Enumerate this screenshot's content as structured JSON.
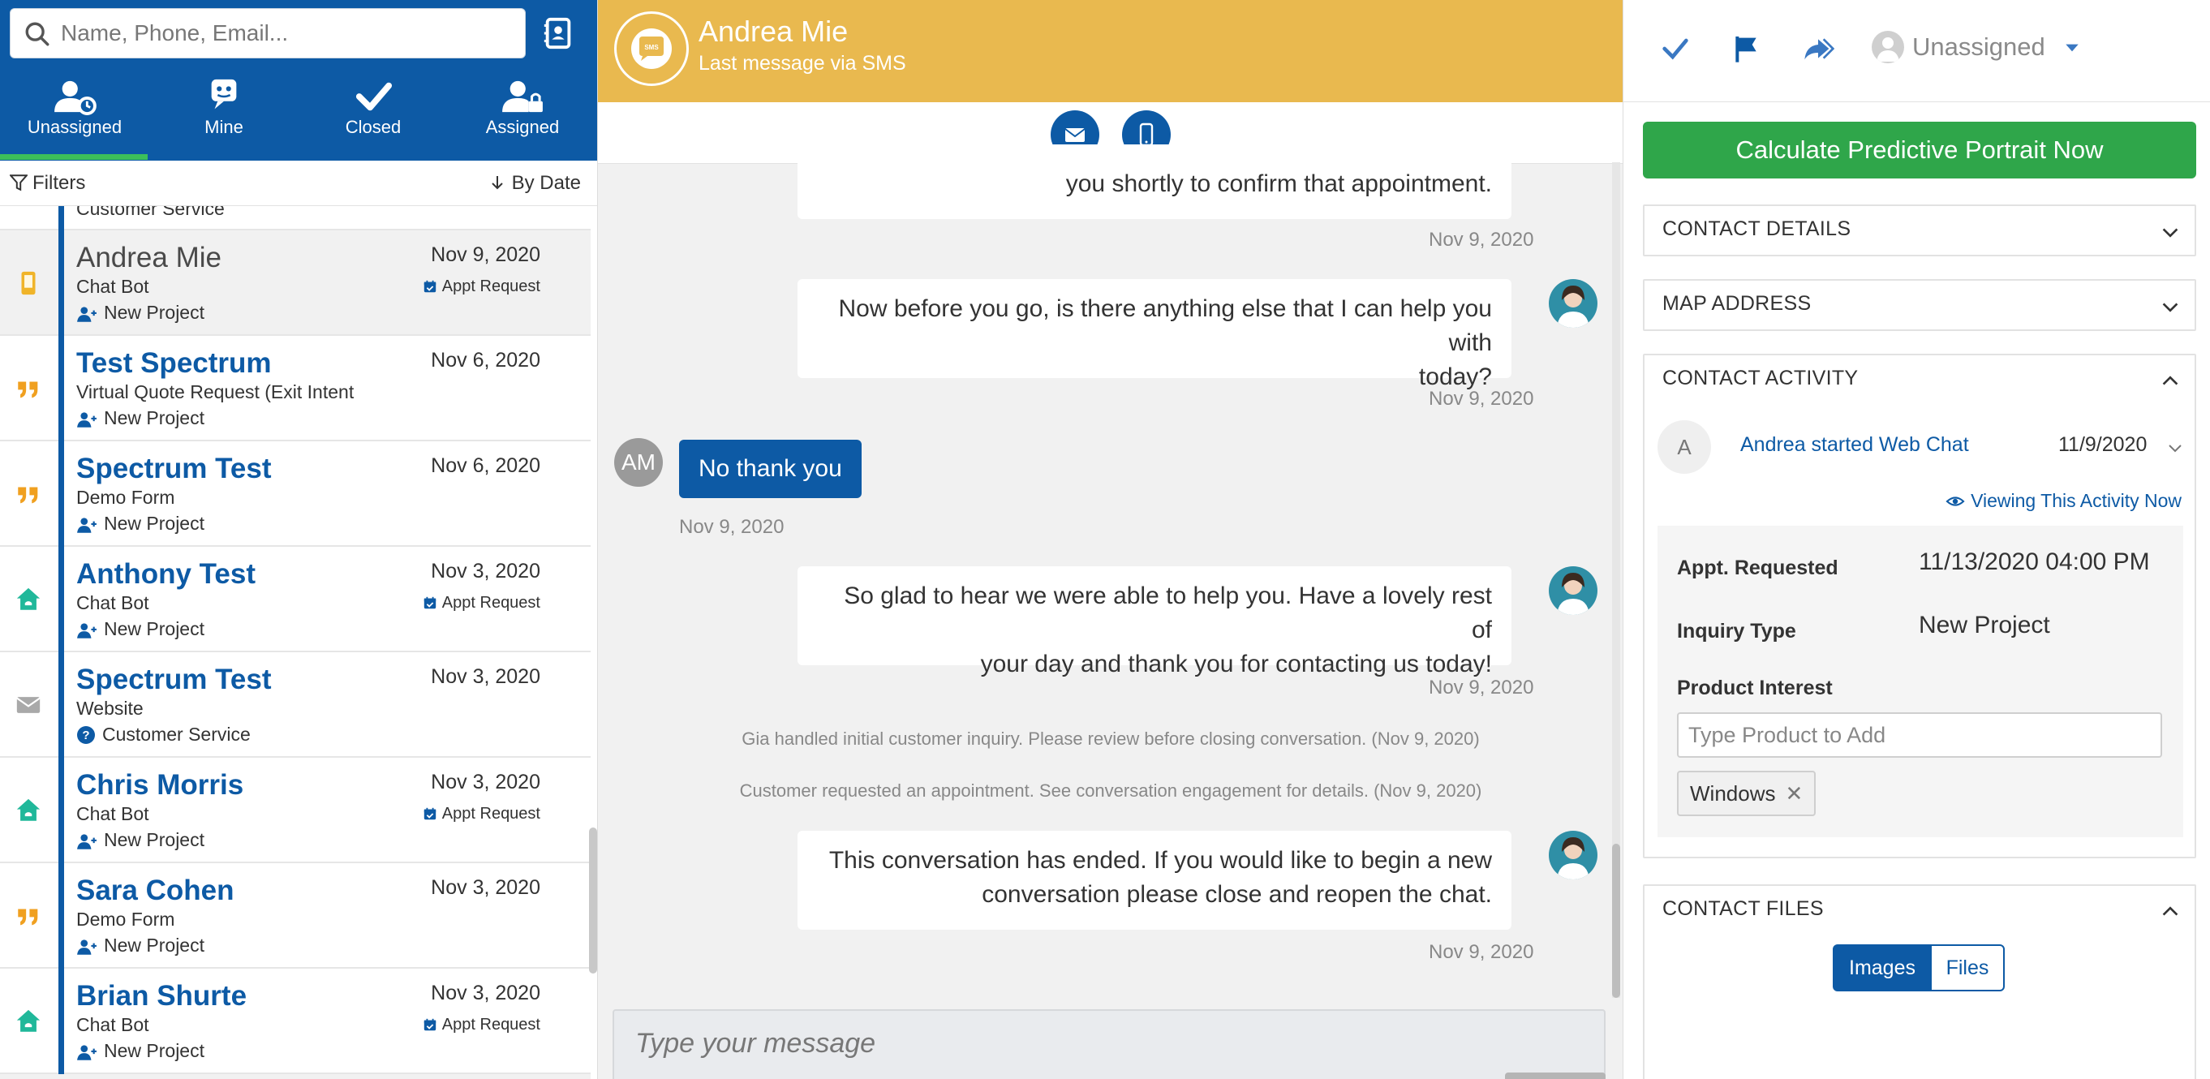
{
  "search": {
    "placeholder": "Name, Phone, Email..."
  },
  "tabs": [
    {
      "label": "Unassigned",
      "icon": "user-clock-icon"
    },
    {
      "label": "Mine",
      "icon": "chat-bot-icon"
    },
    {
      "label": "Closed",
      "icon": "check-icon"
    },
    {
      "label": "Assigned",
      "icon": "user-lock-icon"
    }
  ],
  "filters": {
    "filters_label": "Filters",
    "sort_label": "By Date"
  },
  "list": {
    "partial_tag": "Customer Service",
    "rows": [
      {
        "name": "Andrea Mie",
        "source": "Chat Bot",
        "tag": "New Project",
        "date": "Nov 9, 2020",
        "appt": "Appt Request",
        "src_icon": "mobile-icon",
        "selected": true
      },
      {
        "name": "Test Spectrum",
        "source": "Virtual Quote Request (Exit Intent",
        "tag": "New Project",
        "date": "Nov 6, 2020",
        "appt": "",
        "src_icon": "quote-icon"
      },
      {
        "name": "Spectrum Test",
        "source": "Demo Form",
        "tag": "New Project",
        "date": "Nov 6, 2020",
        "appt": "",
        "src_icon": "quote-icon"
      },
      {
        "name": "Anthony Test",
        "source": "Chat Bot",
        "tag": "New Project",
        "date": "Nov 3, 2020",
        "appt": "Appt Request",
        "src_icon": "home-icon"
      },
      {
        "name": "Spectrum Test",
        "source": "Website",
        "tag": "Customer Service",
        "date": "Nov 3, 2020",
        "appt": "",
        "src_icon": "envelope-icon"
      },
      {
        "name": "Chris Morris",
        "source": "Chat Bot",
        "tag": "New Project",
        "date": "Nov 3, 2020",
        "appt": "Appt Request",
        "src_icon": "home-icon"
      },
      {
        "name": "Sara Cohen",
        "source": "Demo Form",
        "tag": "New Project",
        "date": "Nov 3, 2020",
        "appt": "",
        "src_icon": "quote-icon"
      },
      {
        "name": "Brian Shurte",
        "source": "Chat Bot",
        "tag": "New Project",
        "date": "Nov 3, 2020",
        "appt": "Appt Request",
        "src_icon": "home-icon"
      }
    ]
  },
  "chat": {
    "contact_name": "Andrea Mie",
    "subtitle": "Last message via SMS",
    "messages": [
      {
        "text": "you shortly to confirm that appointment.",
        "time": "Nov 9, 2020"
      },
      {
        "line1": "Now before you go, is there anything else that I can help you with",
        "line2": "today?",
        "time": "Nov 9, 2020"
      },
      {
        "text": "No thank you",
        "initials": "AM",
        "time": "Nov 9, 2020"
      },
      {
        "line1": "So glad to hear we were able to help you. Have a lovely rest of",
        "line2": "your day and thank you for contacting us today!",
        "time": "Nov 9, 2020"
      },
      {
        "line1": "This conversation has ended. If you would like to begin a new",
        "line2": "conversation please close and reopen the chat.",
        "time": "Nov 9, 2020"
      }
    ],
    "system": [
      "Gia handled initial customer inquiry. Please review before closing conversation. (Nov 9, 2020)",
      "Customer requested an appointment. See conversation engagement for details. (Nov 9, 2020)"
    ],
    "compose_placeholder": "Type your message"
  },
  "right": {
    "assignee": "Unassigned",
    "calc_button": "Calculate Predictive Portrait Now",
    "sections": {
      "contact_details": "CONTACT DETAILS",
      "map_address": "MAP ADDRESS",
      "contact_activity": "CONTACT ACTIVITY",
      "contact_files": "CONTACT FILES"
    },
    "activity": {
      "avatar": "A",
      "title": "Andrea started Web Chat",
      "date": "11/9/2020",
      "viewing": "Viewing This Activity Now",
      "appt_label": "Appt. Requested",
      "appt_value": "11/13/2020 04:00 PM",
      "inquiry_label": "Inquiry Type",
      "inquiry_value": "New Project",
      "product_label": "Product Interest",
      "product_placeholder": "Type Product to Add",
      "chip": "Windows"
    },
    "files_tabs": {
      "images": "Images",
      "files": "Files"
    }
  },
  "colors": {
    "brand_blue": "#0d5aa5",
    "header_yellow": "#e9b94f",
    "calc_green": "#2fa64a",
    "tab_indicator": "#3cbf5a",
    "quote_orange": "#f0a020",
    "home_teal": "#20b89a"
  }
}
